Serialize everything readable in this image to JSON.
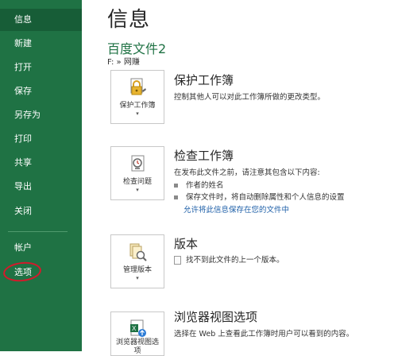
{
  "sidebar": {
    "items": [
      {
        "label": "信息"
      },
      {
        "label": "新建"
      },
      {
        "label": "打开"
      },
      {
        "label": "保存"
      },
      {
        "label": "另存为"
      },
      {
        "label": "打印"
      },
      {
        "label": "共享"
      },
      {
        "label": "导出"
      },
      {
        "label": "关闭"
      },
      {
        "label": "帐户"
      },
      {
        "label": "选项"
      }
    ]
  },
  "main": {
    "title": "信息",
    "doc_name": "百度文件2",
    "doc_path": "F: » 网赚",
    "sections": [
      {
        "button_label": "保护工作簿",
        "title": "保护工作簿",
        "desc": "控制其他人可以对此工作簿所做的更改类型。"
      },
      {
        "button_label": "检查问题",
        "title": "检查工作簿",
        "desc": "在发布此文件之前，请注意其包含以下内容:",
        "bullets": [
          "作者的姓名",
          "保存文件时，将自动删除属性和个人信息的设置"
        ],
        "link": "允许将此信息保存在您的文件中"
      },
      {
        "button_label": "管理版本",
        "title": "版本",
        "desc": "找不到此文件的上一个版本。"
      },
      {
        "button_label": "浏览器视图选项",
        "title": "浏览器视图选项",
        "desc": "选择在 Web 上查看此工作簿时用户可以看到的内容。"
      }
    ]
  },
  "colors": {
    "sidebar": "#1f7244",
    "active": "#175d37",
    "accent": "#1f7244",
    "highlight_oval": "#d6192b"
  }
}
